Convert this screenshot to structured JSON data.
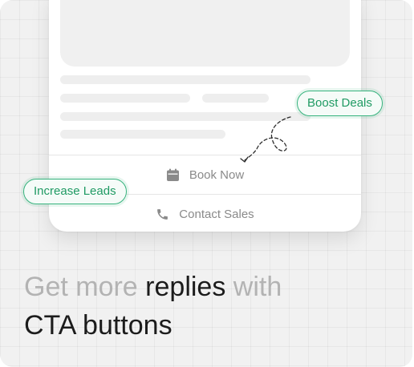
{
  "buttons": {
    "book_now": "Book Now",
    "contact_sales": "Contact Sales"
  },
  "tags": {
    "boost_deals": "Boost Deals",
    "increase_leads": "Increase Leads"
  },
  "headline": {
    "part1": "Get more ",
    "part2": "replies",
    "part3": " with",
    "line2": "CTA buttons"
  },
  "colors": {
    "accent_green": "#1f9a63",
    "muted_text": "#b3b3b3",
    "background": "#f1f1f1"
  },
  "icons": [
    "calendar-icon",
    "phone-icon"
  ]
}
